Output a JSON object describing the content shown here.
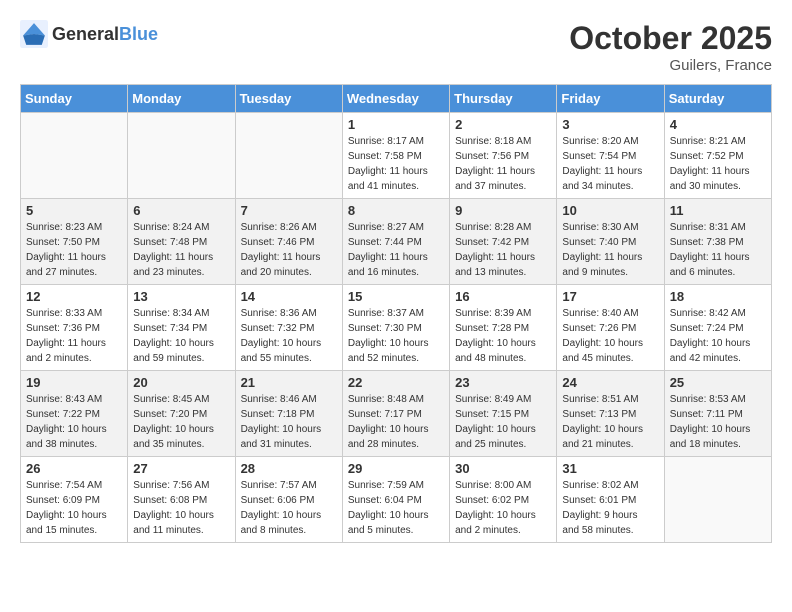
{
  "header": {
    "logo_general": "General",
    "logo_blue": "Blue",
    "month_title": "October 2025",
    "location": "Guilers, France"
  },
  "weekdays": [
    "Sunday",
    "Monday",
    "Tuesday",
    "Wednesday",
    "Thursday",
    "Friday",
    "Saturday"
  ],
  "weeks": [
    [
      {
        "day": "",
        "info": ""
      },
      {
        "day": "",
        "info": ""
      },
      {
        "day": "",
        "info": ""
      },
      {
        "day": "1",
        "info": "Sunrise: 8:17 AM\nSunset: 7:58 PM\nDaylight: 11 hours\nand 41 minutes."
      },
      {
        "day": "2",
        "info": "Sunrise: 8:18 AM\nSunset: 7:56 PM\nDaylight: 11 hours\nand 37 minutes."
      },
      {
        "day": "3",
        "info": "Sunrise: 8:20 AM\nSunset: 7:54 PM\nDaylight: 11 hours\nand 34 minutes."
      },
      {
        "day": "4",
        "info": "Sunrise: 8:21 AM\nSunset: 7:52 PM\nDaylight: 11 hours\nand 30 minutes."
      }
    ],
    [
      {
        "day": "5",
        "info": "Sunrise: 8:23 AM\nSunset: 7:50 PM\nDaylight: 11 hours\nand 27 minutes."
      },
      {
        "day": "6",
        "info": "Sunrise: 8:24 AM\nSunset: 7:48 PM\nDaylight: 11 hours\nand 23 minutes."
      },
      {
        "day": "7",
        "info": "Sunrise: 8:26 AM\nSunset: 7:46 PM\nDaylight: 11 hours\nand 20 minutes."
      },
      {
        "day": "8",
        "info": "Sunrise: 8:27 AM\nSunset: 7:44 PM\nDaylight: 11 hours\nand 16 minutes."
      },
      {
        "day": "9",
        "info": "Sunrise: 8:28 AM\nSunset: 7:42 PM\nDaylight: 11 hours\nand 13 minutes."
      },
      {
        "day": "10",
        "info": "Sunrise: 8:30 AM\nSunset: 7:40 PM\nDaylight: 11 hours\nand 9 minutes."
      },
      {
        "day": "11",
        "info": "Sunrise: 8:31 AM\nSunset: 7:38 PM\nDaylight: 11 hours\nand 6 minutes."
      }
    ],
    [
      {
        "day": "12",
        "info": "Sunrise: 8:33 AM\nSunset: 7:36 PM\nDaylight: 11 hours\nand 2 minutes."
      },
      {
        "day": "13",
        "info": "Sunrise: 8:34 AM\nSunset: 7:34 PM\nDaylight: 10 hours\nand 59 minutes."
      },
      {
        "day": "14",
        "info": "Sunrise: 8:36 AM\nSunset: 7:32 PM\nDaylight: 10 hours\nand 55 minutes."
      },
      {
        "day": "15",
        "info": "Sunrise: 8:37 AM\nSunset: 7:30 PM\nDaylight: 10 hours\nand 52 minutes."
      },
      {
        "day": "16",
        "info": "Sunrise: 8:39 AM\nSunset: 7:28 PM\nDaylight: 10 hours\nand 48 minutes."
      },
      {
        "day": "17",
        "info": "Sunrise: 8:40 AM\nSunset: 7:26 PM\nDaylight: 10 hours\nand 45 minutes."
      },
      {
        "day": "18",
        "info": "Sunrise: 8:42 AM\nSunset: 7:24 PM\nDaylight: 10 hours\nand 42 minutes."
      }
    ],
    [
      {
        "day": "19",
        "info": "Sunrise: 8:43 AM\nSunset: 7:22 PM\nDaylight: 10 hours\nand 38 minutes."
      },
      {
        "day": "20",
        "info": "Sunrise: 8:45 AM\nSunset: 7:20 PM\nDaylight: 10 hours\nand 35 minutes."
      },
      {
        "day": "21",
        "info": "Sunrise: 8:46 AM\nSunset: 7:18 PM\nDaylight: 10 hours\nand 31 minutes."
      },
      {
        "day": "22",
        "info": "Sunrise: 8:48 AM\nSunset: 7:17 PM\nDaylight: 10 hours\nand 28 minutes."
      },
      {
        "day": "23",
        "info": "Sunrise: 8:49 AM\nSunset: 7:15 PM\nDaylight: 10 hours\nand 25 minutes."
      },
      {
        "day": "24",
        "info": "Sunrise: 8:51 AM\nSunset: 7:13 PM\nDaylight: 10 hours\nand 21 minutes."
      },
      {
        "day": "25",
        "info": "Sunrise: 8:53 AM\nSunset: 7:11 PM\nDaylight: 10 hours\nand 18 minutes."
      }
    ],
    [
      {
        "day": "26",
        "info": "Sunrise: 7:54 AM\nSunset: 6:09 PM\nDaylight: 10 hours\nand 15 minutes."
      },
      {
        "day": "27",
        "info": "Sunrise: 7:56 AM\nSunset: 6:08 PM\nDaylight: 10 hours\nand 11 minutes."
      },
      {
        "day": "28",
        "info": "Sunrise: 7:57 AM\nSunset: 6:06 PM\nDaylight: 10 hours\nand 8 minutes."
      },
      {
        "day": "29",
        "info": "Sunrise: 7:59 AM\nSunset: 6:04 PM\nDaylight: 10 hours\nand 5 minutes."
      },
      {
        "day": "30",
        "info": "Sunrise: 8:00 AM\nSunset: 6:02 PM\nDaylight: 10 hours\nand 2 minutes."
      },
      {
        "day": "31",
        "info": "Sunrise: 8:02 AM\nSunset: 6:01 PM\nDaylight: 9 hours\nand 58 minutes."
      },
      {
        "day": "",
        "info": ""
      }
    ]
  ]
}
